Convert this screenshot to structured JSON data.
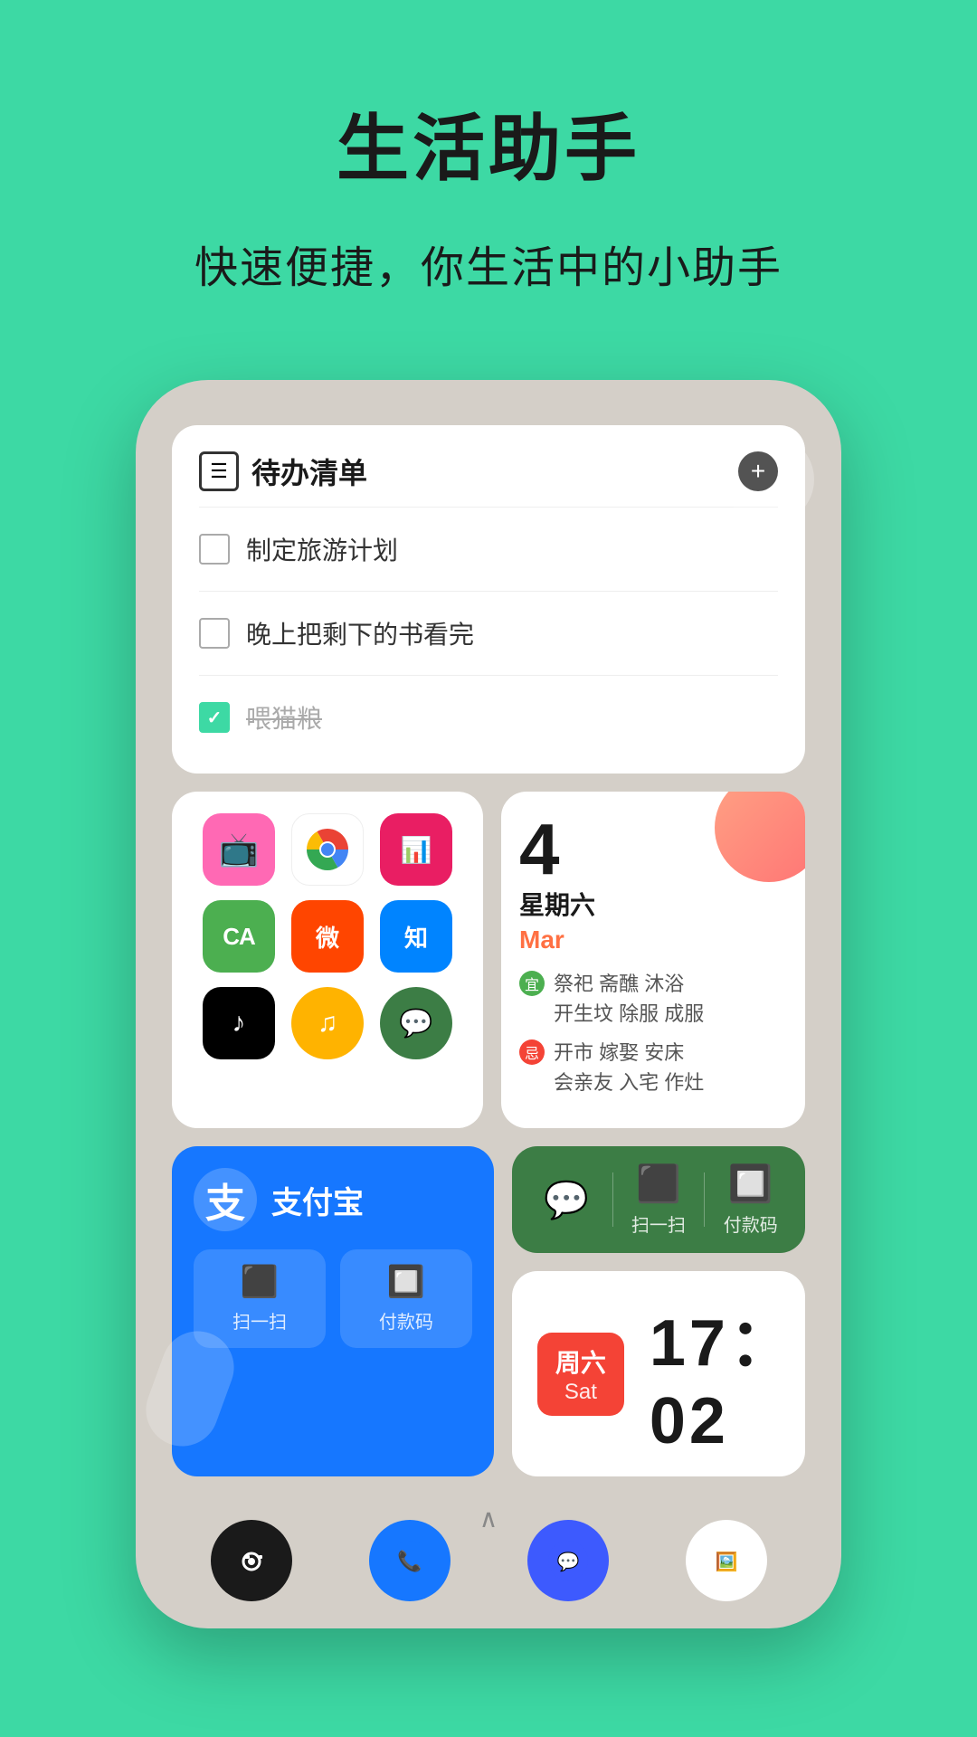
{
  "header": {
    "main_title": "生活助手",
    "sub_title": "快速便捷，你生活中的小助手"
  },
  "todo_widget": {
    "title": "待办清单",
    "add_label": "+",
    "items": [
      {
        "text": "制定旅游计划",
        "checked": false
      },
      {
        "text": "晚上把剩下的书看完",
        "checked": false
      },
      {
        "text": "喂猫粮",
        "checked": true
      }
    ]
  },
  "apps_widget": {
    "rows": [
      [
        {
          "name": "tv-app",
          "bg": "#FF69B4",
          "icon": "📺"
        },
        {
          "name": "chrome",
          "bg": "#fff",
          "icon": "🌐"
        },
        {
          "name": "hiit",
          "bg": "#E91E63",
          "icon": "📊"
        }
      ],
      [
        {
          "name": "green-app",
          "bg": "#4CAF50",
          "icon": "CA"
        },
        {
          "name": "weibo",
          "bg": "#FF4500",
          "icon": "微"
        },
        {
          "name": "zhihu",
          "bg": "#0084FF",
          "icon": "知"
        }
      ],
      [
        {
          "name": "tiktok",
          "bg": "#000",
          "icon": "♪"
        },
        {
          "name": "music",
          "bg": "#FFB300",
          "icon": "♫"
        },
        {
          "name": "wechat",
          "bg": "#3C7D45",
          "icon": "💬"
        }
      ]
    ]
  },
  "calendar_widget": {
    "date": "4",
    "weekday": "星期六",
    "month": "Mar",
    "auspicious_label": "宜",
    "auspicious_items": "祭祀  斋醮  沐浴\n开生坟  除服  成服",
    "inauspicious_label": "忌",
    "inauspicious_items": "开市  嫁娶  安床\n会亲友  入宅  作灶"
  },
  "alipay_widget": {
    "name": "支付宝",
    "logo": "支",
    "scan_label": "扫一扫",
    "pay_label": "付款码"
  },
  "wechat_pay_widget": {
    "scan_label": "扫一扫",
    "pay_label": "付款码"
  },
  "clock_widget": {
    "weekday_zh": "周六",
    "weekday_en": "Sat",
    "time": "17：02"
  },
  "dock": {
    "items": [
      {
        "name": "camera",
        "icon": "📷"
      },
      {
        "name": "phone",
        "icon": "📞"
      },
      {
        "name": "message",
        "icon": "💬"
      },
      {
        "name": "gallery",
        "icon": "🖼️"
      }
    ]
  }
}
